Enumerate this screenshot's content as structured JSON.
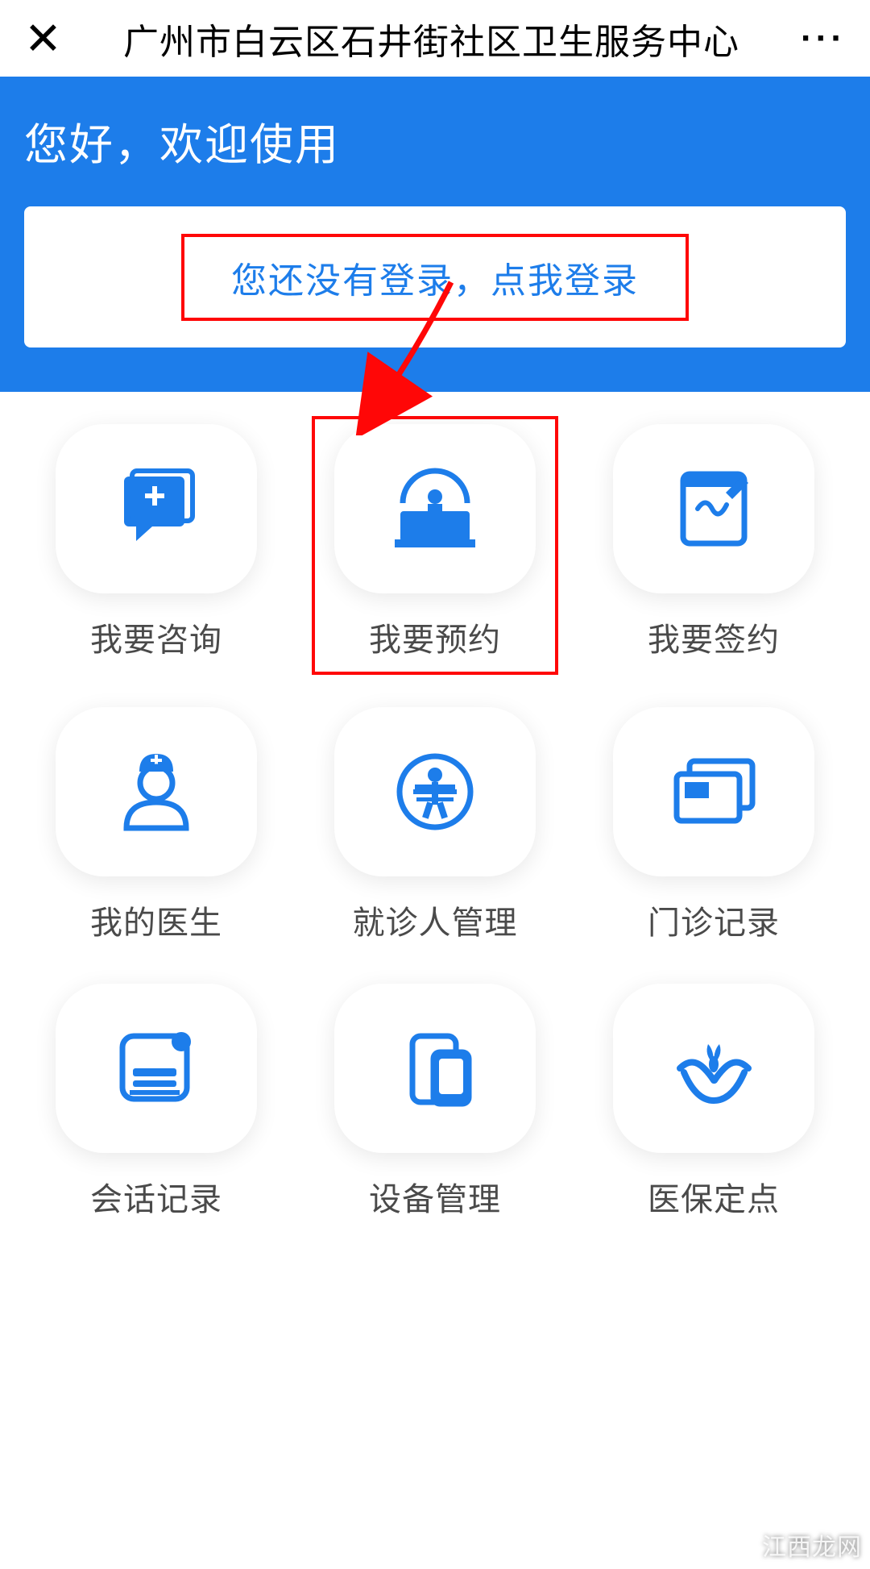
{
  "header": {
    "title": "广州市白云区石井街社区卫生服务中心"
  },
  "hero": {
    "welcome": "您好，欢迎使用",
    "login_prompt": "您还没有登录，点我登录"
  },
  "grid": {
    "items": [
      {
        "label": "我要咨询",
        "icon": "consult-icon"
      },
      {
        "label": "我要预约",
        "icon": "appointment-icon"
      },
      {
        "label": "我要签约",
        "icon": "sign-icon"
      },
      {
        "label": "我的医生",
        "icon": "doctor-icon"
      },
      {
        "label": "就诊人管理",
        "icon": "patient-manage-icon"
      },
      {
        "label": "门诊记录",
        "icon": "clinic-record-icon"
      },
      {
        "label": "会话记录",
        "icon": "chat-record-icon"
      },
      {
        "label": "设备管理",
        "icon": "device-icon"
      },
      {
        "label": "医保定点",
        "icon": "insurance-icon"
      }
    ]
  },
  "annotations": {
    "highlight_login": true,
    "highlight_cell_index": 1
  },
  "watermark": "江西龙网"
}
